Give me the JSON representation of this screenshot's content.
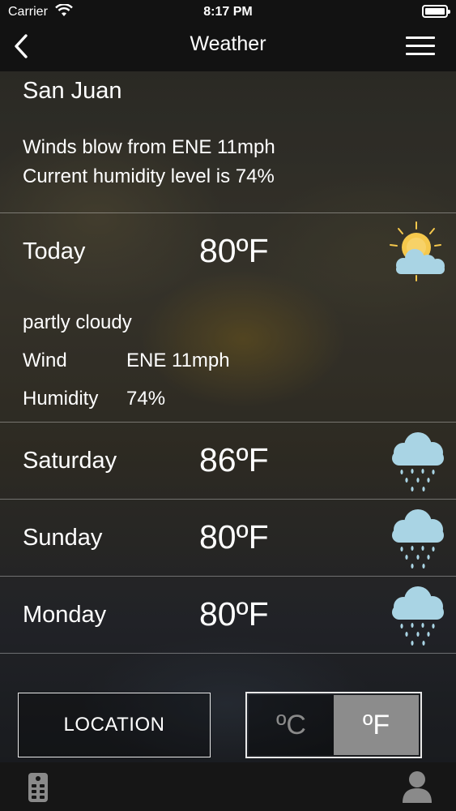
{
  "status_bar": {
    "carrier": "Carrier",
    "time": "8:17 PM"
  },
  "nav": {
    "title": "Weather",
    "back_icon": "chevron-left-icon",
    "menu_icon": "hamburger-menu-icon"
  },
  "location": {
    "city": "San Juan",
    "wind_summary": "Winds blow from ENE 11mph",
    "humidity_summary": "Current humidity level is 74%"
  },
  "today": {
    "label": "Today",
    "temp": "80ºF",
    "icon": "partly-cloudy-icon",
    "condition": "partly cloudy",
    "wind_label": "Wind",
    "wind_value": "ENE 11mph",
    "humidity_label": "Humidity",
    "humidity_value": "74%"
  },
  "forecast": [
    {
      "label": "Saturday",
      "temp": "86ºF",
      "icon": "rain-cloud-icon"
    },
    {
      "label": "Sunday",
      "temp": "80ºF",
      "icon": "rain-cloud-icon"
    },
    {
      "label": "Monday",
      "temp": "80ºF",
      "icon": "rain-cloud-icon"
    }
  ],
  "controls": {
    "location_label": "LOCATION",
    "celsius_label": "ºC",
    "fahrenheit_label": "ºF",
    "selected_unit": "F"
  },
  "tabbar": {
    "left_icon": "remote-control-icon",
    "right_icon": "user-profile-icon"
  },
  "colors": {
    "cloud": "#a9d4e4",
    "sun": "#f5c84c",
    "rain": "#a9d4e4",
    "toggle_selected": "#8c8c8c"
  }
}
